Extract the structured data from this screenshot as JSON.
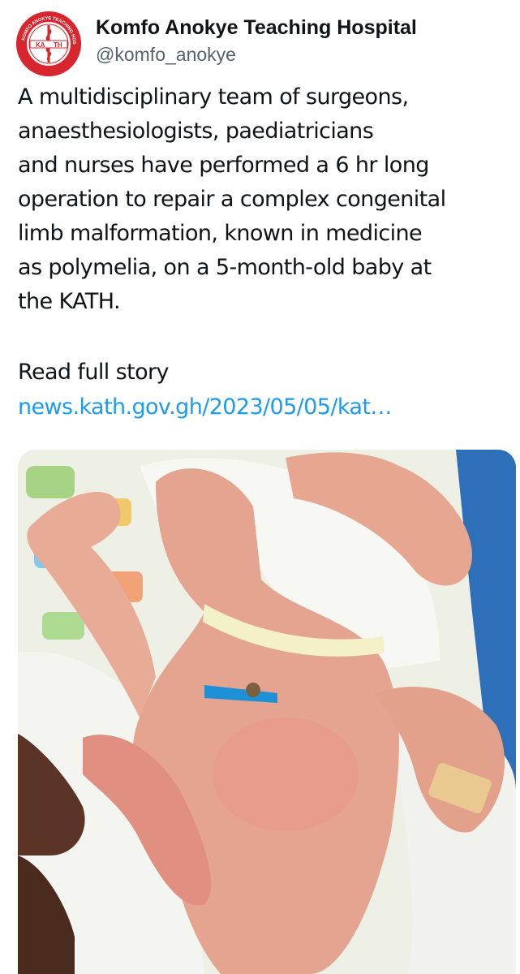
{
  "tweet": {
    "author": {
      "display_name": "Komfo Anokye Teaching Hospital",
      "handle": "@komfo_anokye",
      "avatar_icon": "hospital-crest-logo",
      "avatar_text": "KATH",
      "avatar_ring_text": "KOMFO ANOKYE TEACHING HOSPITAL, KUMASI"
    },
    "text_lines": [
      "A multidisciplinary team of surgeons,",
      "anaesthesiologists, paediatricians",
      "and nurses have performed a 6 hr long",
      "operation to repair a complex congenital",
      "limb malformation, known in medicine",
      "as polymelia, on a 5-month-old baby at",
      "the KATH."
    ],
    "read_more": "Read full story",
    "link_text": "news.kath.gov.gh/2023/05/05/kat…",
    "media_icon": "photo-baby-on-blanket",
    "colors": {
      "link": "#1d9bf0",
      "handle": "#536471",
      "text": "#0f1419",
      "avatar_brand": "#d8262e"
    }
  }
}
